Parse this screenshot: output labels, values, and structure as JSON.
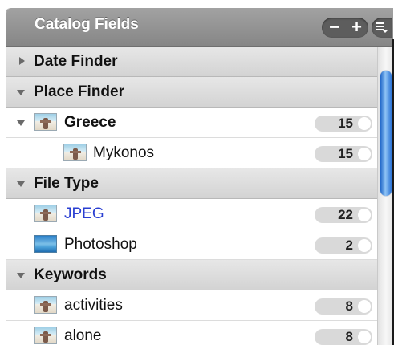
{
  "header": {
    "title": "Catalog Fields",
    "minus_label": "−",
    "plus_label": "+"
  },
  "icons": {
    "options": "list-options-icon",
    "photo": "photo-thumbnail-icon"
  },
  "colors": {
    "link": "#2a3fd2",
    "header": "#8f8f8f",
    "scroll_thumb": "#2b73d6"
  },
  "rows": [
    {
      "label": "Date Finder",
      "count": ""
    },
    {
      "label": "Place Finder",
      "count": ""
    },
    {
      "label": "Greece",
      "count": "15"
    },
    {
      "label": "Mykonos",
      "count": "15"
    },
    {
      "label": "File Type",
      "count": ""
    },
    {
      "label": "JPEG",
      "count": "22"
    },
    {
      "label": "Photoshop",
      "count": "2"
    },
    {
      "label": "Keywords",
      "count": ""
    },
    {
      "label": "activities",
      "count": "8"
    },
    {
      "label": "alone",
      "count": "8"
    }
  ]
}
